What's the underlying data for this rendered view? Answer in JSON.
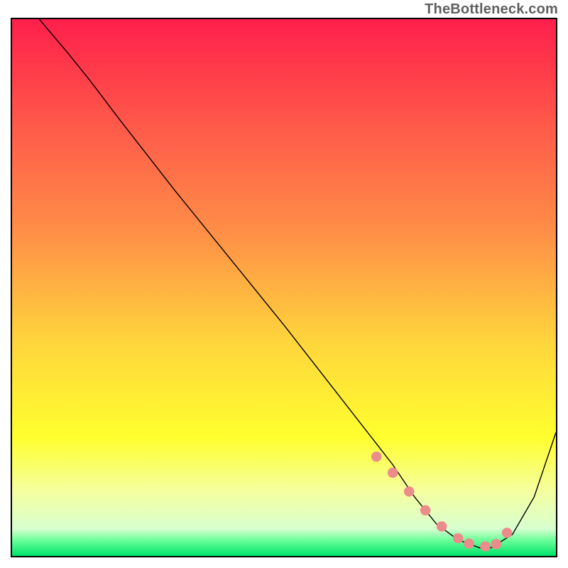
{
  "watermark": "TheBottleneck.com",
  "chart_data": {
    "type": "line",
    "title": "",
    "xlabel": "",
    "ylabel": "",
    "xlim": [
      0,
      100
    ],
    "ylim": [
      0,
      100
    ],
    "background_gradient": {
      "stops": [
        {
          "pos": 0.0,
          "color": "#ff1f4b"
        },
        {
          "pos": 0.2,
          "color": "#ff5a4a"
        },
        {
          "pos": 0.4,
          "color": "#ff8f47"
        },
        {
          "pos": 0.6,
          "color": "#ffd53c"
        },
        {
          "pos": 0.78,
          "color": "#ffff2e"
        },
        {
          "pos": 0.88,
          "color": "#f5ffa0"
        },
        {
          "pos": 0.95,
          "color": "#d7ffd0"
        },
        {
          "pos": 0.97,
          "color": "#6dff9a"
        },
        {
          "pos": 1.0,
          "color": "#00e46b"
        }
      ]
    },
    "series": [
      {
        "name": "bottleneck-curve",
        "color": "#000000",
        "x": [
          5,
          10,
          14,
          20,
          30,
          40,
          50,
          60,
          65,
          70,
          74,
          78,
          82,
          86,
          88,
          92,
          96,
          100
        ],
        "y": [
          100,
          94,
          89,
          81,
          68,
          55.5,
          43,
          30,
          23.5,
          17,
          11,
          6,
          3,
          1.5,
          1.5,
          4,
          11,
          23
        ]
      }
    ],
    "highlight": {
      "name": "valley-highlight",
      "color": "#ec8b8b",
      "x": [
        67,
        70,
        73,
        76,
        79,
        82,
        84,
        87,
        89,
        91
      ],
      "y": [
        18.5,
        15.5,
        12,
        8.5,
        5.5,
        3.3,
        2.3,
        1.8,
        2.2,
        4.3
      ]
    }
  }
}
